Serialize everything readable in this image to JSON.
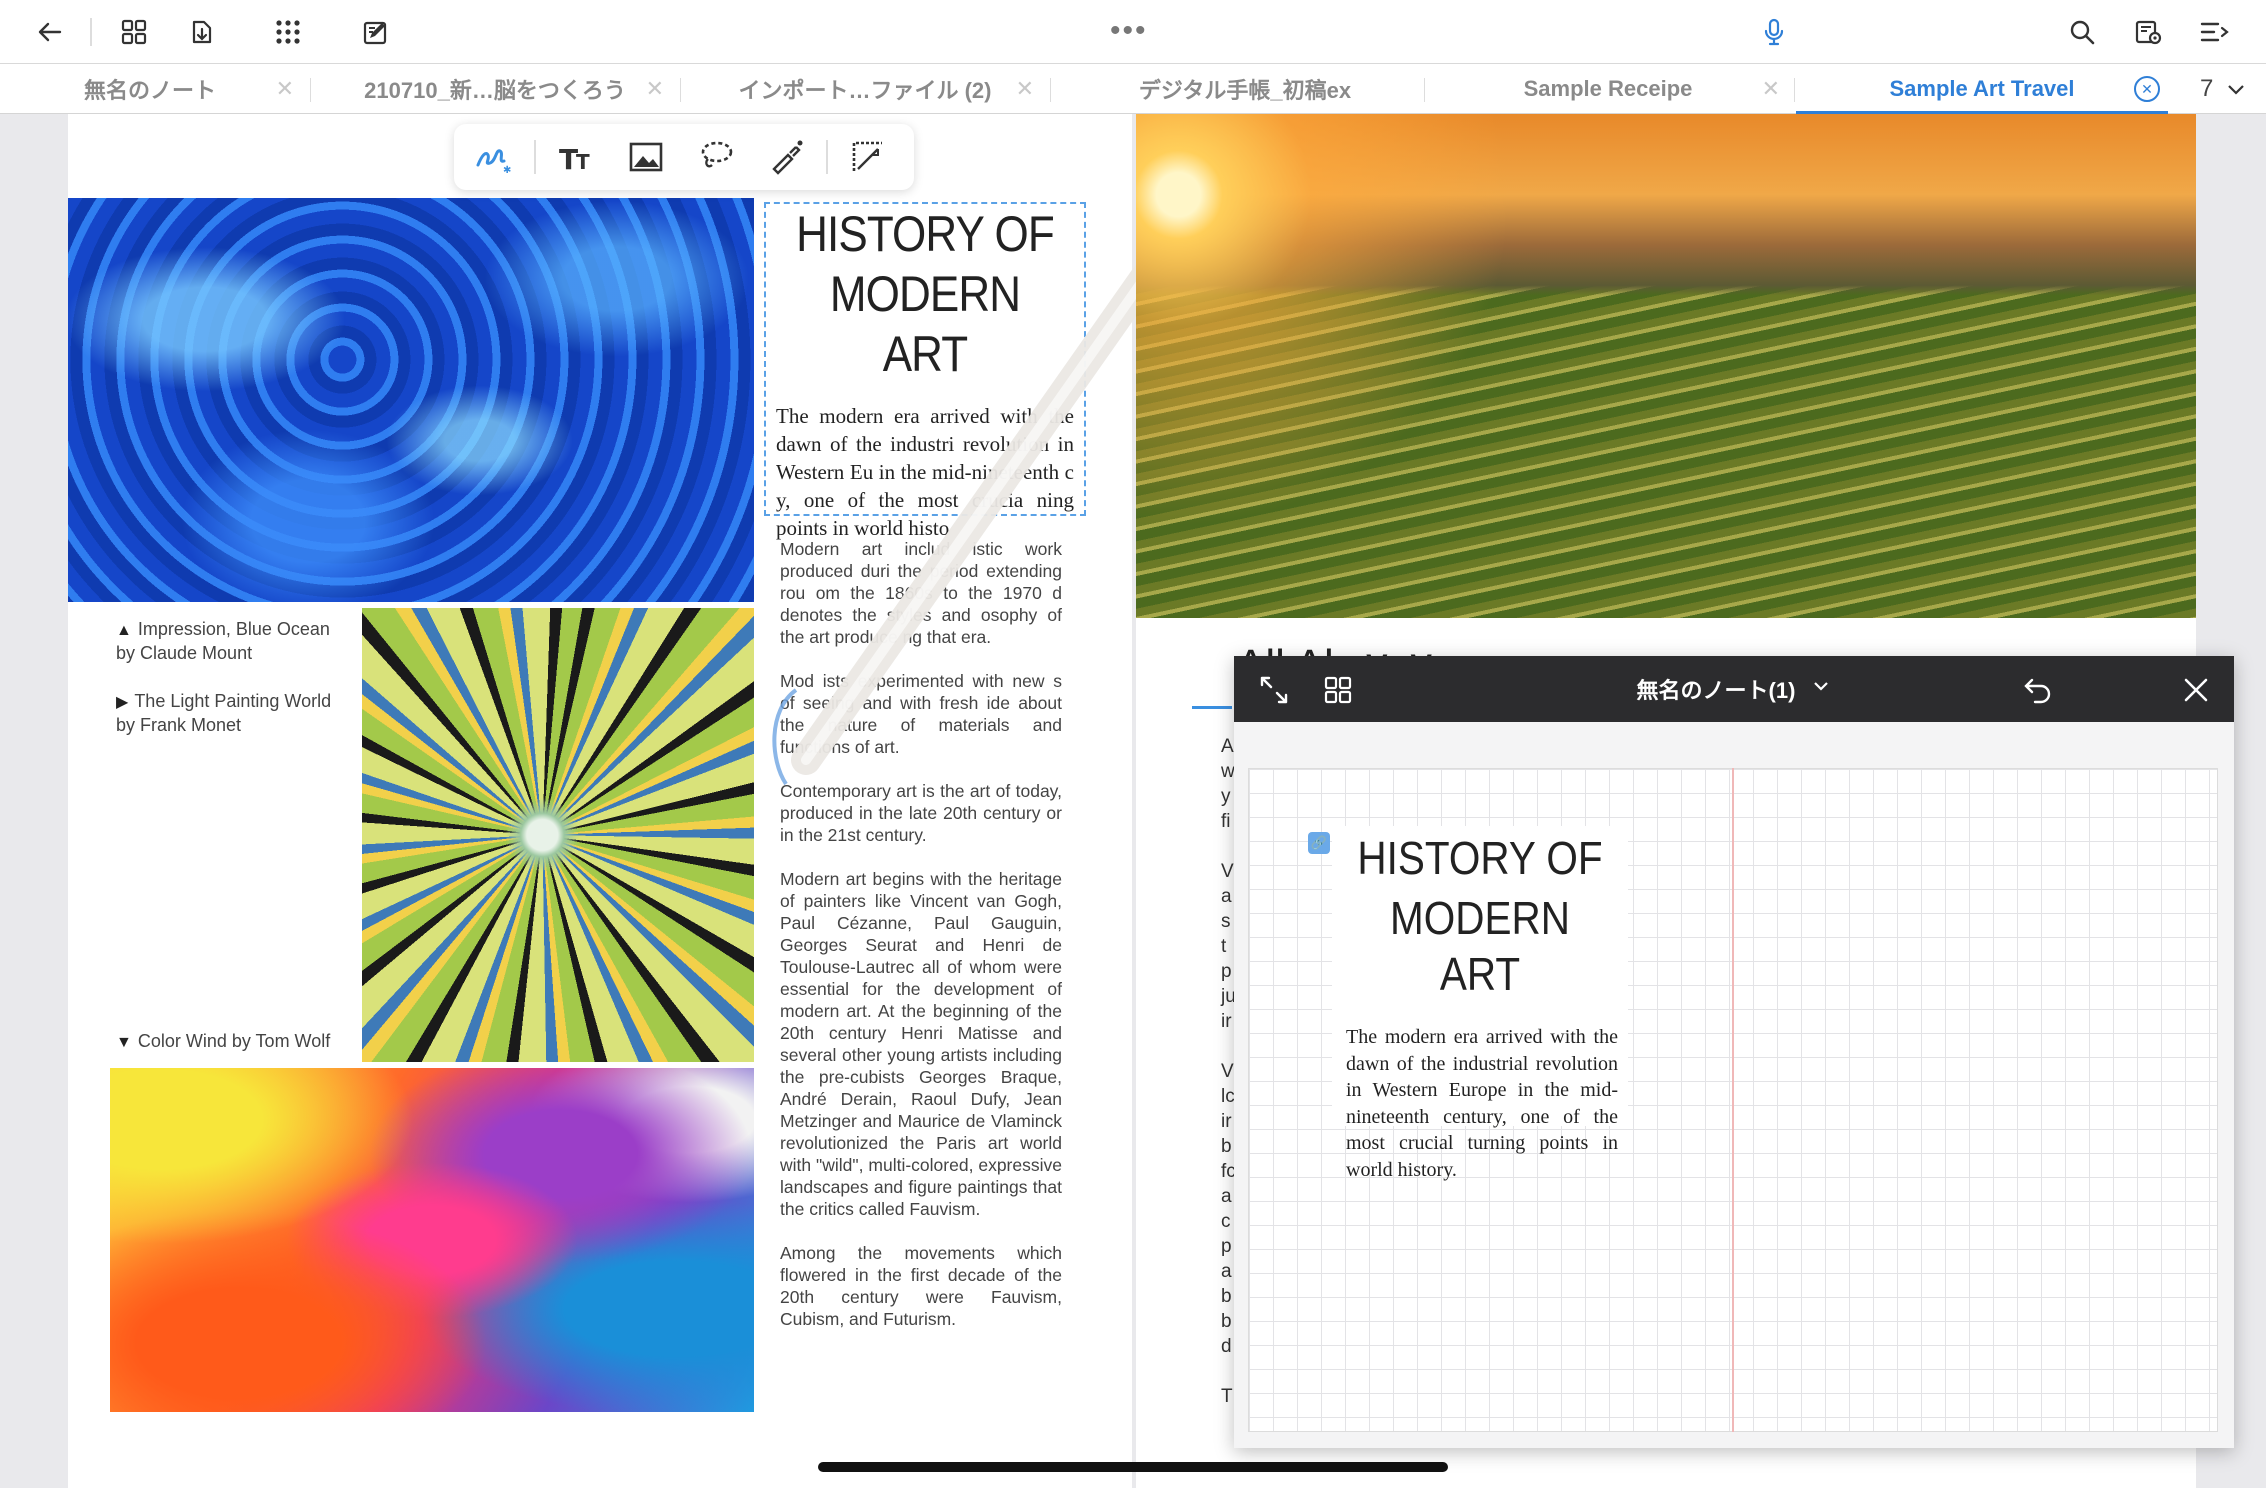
{
  "toolbar": {
    "left_icons": [
      "back-arrow-icon",
      "grid-icon",
      "export-icon",
      "apps-icon",
      "edit-notes-icon"
    ],
    "more_label": "•••",
    "right_icons": [
      "microphone-icon",
      "search-icon",
      "settings-page-icon",
      "outline-menu-icon"
    ]
  },
  "tabs": [
    {
      "label": "無名のノート",
      "active": false
    },
    {
      "label": "210710_新…脳をつくろう",
      "active": false
    },
    {
      "label": "インポート…ファイル (2)",
      "active": false
    },
    {
      "label": "デジタル手帳_初稿ex",
      "active": false
    },
    {
      "label": "Sample Receipe",
      "active": false
    },
    {
      "label": "Sample Art Travel",
      "active": true
    }
  ],
  "tab_count": "7",
  "palette": [
    "pen-tool-icon",
    "text-tool-icon",
    "image-tool-icon",
    "lasso-tool-icon",
    "laser-pointer-icon",
    "shape-tool-icon"
  ],
  "left_page": {
    "captions": [
      {
        "marker": "▲",
        "line1": "Impression, Blue Ocean",
        "line2": "by Claude Mount"
      },
      {
        "marker": "▶",
        "line1": "The Light Painting World",
        "line2": "by Frank Monet"
      },
      {
        "marker": "▼",
        "line1": "Color Wind by Tom Wolf",
        "line2": ""
      }
    ],
    "title_line1": "HISTORY OF",
    "title_line2": "MODERN ART",
    "intro": "The modern era arrived with the dawn of the industri revolution in Western Eu in the mid-nineteenth c y, one of the most crucia ning points in world histo",
    "paragraphs": [
      "Modern art includ istic work produced duri the period extending rou om the 1860s to the 1970 d denotes the styles and osophy of the art produce ng that era.",
      "Mod ists experimented with new s of seeing and with fresh ide about the nature of materials and functions of art.",
      "Contemporary art is the art of today, produced in the late 20th century or in the 21st century.",
      "Modern art begins with the heritage of painters like Vincent van Gogh, Paul Cézanne, Paul Gauguin, Georges Seurat and Henri de Toulouse-Lautrec all of whom were essential for the development of modern art. At the beginning of the 20th century Henri Matisse and several other young artists including the pre-cubists Georges Braque, André Derain, Raoul Dufy, Jean Metzinger and Maurice de Vlaminck revolutionized the Paris art world with \"wild\", multi-colored, expressive landscapes and figure paintings that the critics called Fauvism.",
      "Among the movements which flowered in the first decade of the 20th century were Fauvism, Cubism, and Futurism."
    ]
  },
  "right_page": {
    "heading_partial": "All  Ab          ∨         ∨",
    "letters": [
      "A",
      "w",
      "y",
      "fi",
      "",
      "V",
      "a",
      "s",
      "t",
      "p",
      "ju",
      "ir",
      "",
      "V",
      "lc",
      "ir",
      "b",
      "fc",
      "a",
      "c",
      "p",
      "a",
      "b",
      "b",
      "d",
      "",
      "T"
    ]
  },
  "subwindow": {
    "title": "無名のノート(1)",
    "chevron": "⌄",
    "title_line1": "HISTORY OF",
    "title_line2": "MODERN ART",
    "intro": "The modern era arrived with the dawn of the industrial revolution in Western Europe in the mid-nineteenth century, one of the most crucial turning points in world history.",
    "link_chip": "🔗"
  }
}
